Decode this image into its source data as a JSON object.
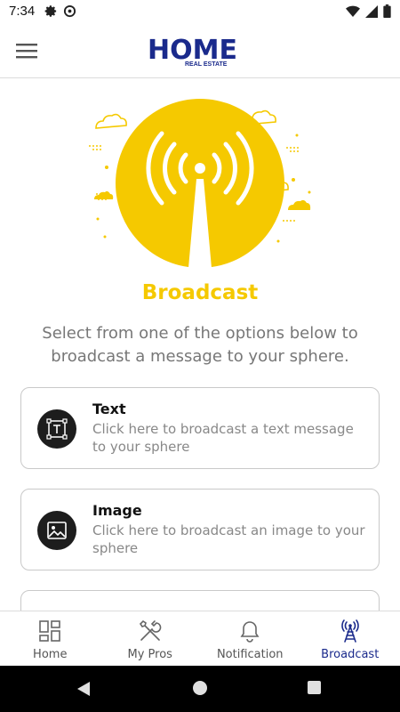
{
  "status_bar": {
    "time": "7:34"
  },
  "app_bar": {
    "logo_text": "HOME",
    "logo_subtext": "REAL ESTATE"
  },
  "main": {
    "title": "Broadcast",
    "subtitle": "Select from one of the options below to broadcast a message to your sphere.",
    "options": [
      {
        "title": "Text",
        "description": "Click here to broadcast a text message to your sphere",
        "icon": "text-box-icon"
      },
      {
        "title": "Image",
        "description": "Click here to broadcast an image to your sphere",
        "icon": "image-icon"
      }
    ]
  },
  "bottom_nav": {
    "items": [
      {
        "label": "Home",
        "icon": "grid-icon"
      },
      {
        "label": "My Pros",
        "icon": "tools-icon"
      },
      {
        "label": "Notification",
        "icon": "bell-icon"
      },
      {
        "label": "Broadcast",
        "icon": "antenna-icon",
        "active": true
      }
    ]
  },
  "colors": {
    "accent_yellow": "#f5c900",
    "brand_navy": "#1a2a8c",
    "muted_text": "#777777"
  }
}
